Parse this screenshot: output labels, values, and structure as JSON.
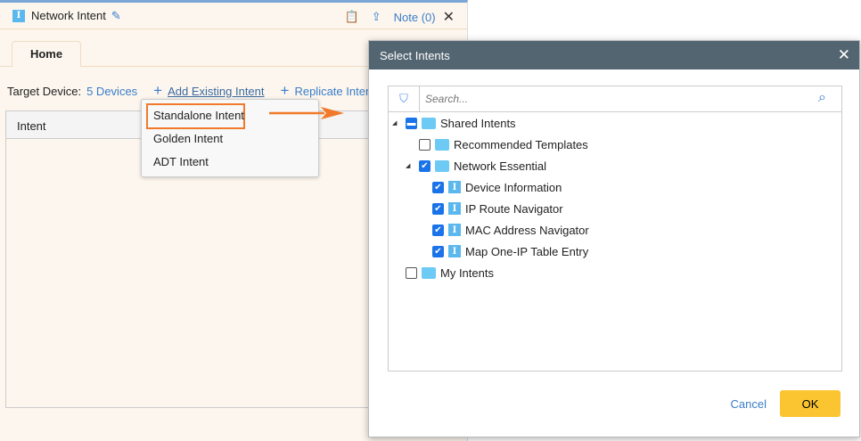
{
  "window": {
    "title": "Network Intent",
    "note": "Note (0)"
  },
  "tabs": [
    {
      "label": "Home"
    }
  ],
  "toolbar": {
    "target_label": "Target Device:",
    "devices": "5 Devices",
    "add_existing": "Add Existing Intent",
    "replicate": "Replicate Intent"
  },
  "grid": {
    "column": "Intent"
  },
  "menu": {
    "items": [
      "Standalone Intent",
      "Golden Intent",
      "ADT Intent"
    ],
    "highlighted": "Standalone Intent"
  },
  "dialog": {
    "title": "Select Intents",
    "search_placeholder": "Search...",
    "cancel": "Cancel",
    "ok": "OK",
    "tree": [
      {
        "label": "Shared Intents",
        "state": "partial"
      },
      {
        "label": "Recommended Templates",
        "state": "unchecked"
      },
      {
        "label": "Network Essential",
        "state": "checked"
      },
      {
        "label": "Device Information",
        "state": "checked"
      },
      {
        "label": "IP Route Navigator",
        "state": "checked"
      },
      {
        "label": "MAC Address Navigator",
        "state": "checked"
      },
      {
        "label": "Map One-IP Table Entry",
        "state": "checked"
      },
      {
        "label": "My Intents",
        "state": "unchecked"
      }
    ]
  },
  "colors": {
    "accent": "#f07a2a",
    "ok": "#fbc531",
    "header": "#546572"
  }
}
